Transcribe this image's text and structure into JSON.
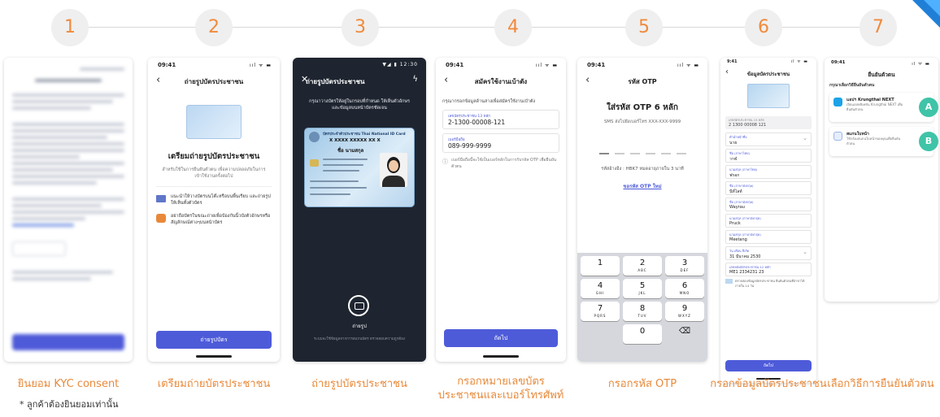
{
  "steps": [
    {
      "num": "1",
      "caption_lines": [
        "ยินยอม KYC consent"
      ]
    },
    {
      "num": "2",
      "caption_lines": [
        "เตรียมถ่ายบัตรประชาชน"
      ]
    },
    {
      "num": "3",
      "caption_lines": [
        "ถ่ายรูปบัตรประชาชน"
      ]
    },
    {
      "num": "4",
      "caption_lines": [
        "กรอกหมายเลขบัตร",
        "ประชาชนและเบอร์โทรศัพท์"
      ]
    },
    {
      "num": "5",
      "caption_lines": [
        "กรอกรหัส OTP"
      ]
    },
    {
      "num": "6",
      "caption_lines": [
        "กรอกข้อมูลบัตรประชาชน"
      ]
    },
    {
      "num": "7",
      "caption_lines": [
        "เลือกวิธีการยืนยันตัวตน"
      ]
    }
  ],
  "footnote": "* ลูกค้าต้องยินยอมเท่านั้น",
  "s2": {
    "time": "09:41",
    "title": "ถ่ายรูปบัตรประชาชน",
    "heading": "เตรียมถ่ายรูปบัตรประชาชน",
    "desc": "สำหรับใช้ในการยืนยันตัวตน เพื่อความปลอดภัยในการเข้าใช้งานครั้งต่อไป",
    "tip1": "แนะนำให้วางบัตรบนโต๊ะหรือบนพื้นเรียบ และถ่ายรูปให้เห็นทั้งตัวบัตร",
    "tip2": "อย่าถือบัตรในขณะถ่ายเพื่อป้องกันนิ้วบังตัวอักษรหรือสัญลักษณ์ต่างๆบนหน้าบัตร",
    "button": "ถ่ายรูปบัตร"
  },
  "s3": {
    "time": "12:30",
    "title": "ถ่ายรูปบัตรประชาชน",
    "hint": "กรุณาวางบัตรให้อยู่ในกรอบที่กำหนด ให้เห็นตัวอักษร และข้อมูลบนหน้าบัตรชัดเจน",
    "card_header": "บัตรประจำตัวประชาชน Thai National ID Card",
    "card_num": "X XXXX XXXXX XX X",
    "card_name": "ชื่อ นามสกุล",
    "shutter_label": "ถ่ายรูป",
    "footer": "ระบบจะใช้ข้อมูลจากการสแกนบัตร ตรวจสอบความถูกต้อง"
  },
  "s4": {
    "time": "09:41",
    "title": "สมัครใช้งานเบ้าตัง",
    "instruction": "กรุณากรอกข้อมูลด้านล่างเพื่อสมัครใช้งานเป๋าตัง",
    "id_label": "เลขบัตรประชาชน 13 หลัก",
    "id_value": "2-1300-00008-121",
    "phone_label": "เบอร์มือถือ",
    "phone_value": "089-999-9999",
    "note": "เบอร์มือถือนี้จะใช้เป็นเบอร์หลักในการรับรหัส OTP เพื่อยืนยันตัวตน",
    "button": "ถัดไป"
  },
  "s5": {
    "time": "09:41",
    "title": "รหัส OTP",
    "heading": "ใส่รหัส OTP 6 หลัก",
    "sent": "SMS ส่งไปยังเบอร์โทร XXX-XXX-9999",
    "ref": "รหัสอ้างอิง : HBK7 หมดอายุภายใน 3 นาที",
    "resend": "ขอรหัส OTP ใหม่",
    "keys": [
      {
        "n": "1",
        "l": ""
      },
      {
        "n": "2",
        "l": "ABC"
      },
      {
        "n": "3",
        "l": "DEF"
      },
      {
        "n": "4",
        "l": "GHI"
      },
      {
        "n": "5",
        "l": "JKL"
      },
      {
        "n": "6",
        "l": "MNO"
      },
      {
        "n": "7",
        "l": "PQRS"
      },
      {
        "n": "8",
        "l": "TUV"
      },
      {
        "n": "9",
        "l": "WXYZ"
      },
      {
        "n": "",
        "l": ""
      },
      {
        "n": "0",
        "l": ""
      },
      {
        "n": "⌫",
        "l": ""
      }
    ]
  },
  "s6": {
    "time": "9:41",
    "title": "ข้อมูลบัตรประชาชน",
    "id_label": "เลขบัตรประชาชน 13 หลัก",
    "id_value": "2 1300 00008 121",
    "fields": [
      {
        "label": "คำนำหน้าชื่อ",
        "value": "นาย"
      },
      {
        "label": "ชื่อ (ภาษาไทย)",
        "value": "วาฬ"
      },
      {
        "label": "นามสกุล (ภาษาไทย)",
        "value": "ฟรอก"
      },
      {
        "label": "ชื่อ (ภาษาอังกฤษ)",
        "value": "นีท์ไลท์"
      },
      {
        "label": "ชื่อ (ภาษาอังกฤษ)",
        "value": "Wayrau"
      },
      {
        "label": "นามสกุล (ภาษาอังกฤษ)",
        "value": "Pruck"
      },
      {
        "label": "นามสกุล (ภาษาอังกฤษ)",
        "value": "Meetang"
      },
      {
        "label": "วัน เดือน ปีเกิด",
        "value": "31 มีนาคม 2530"
      },
      {
        "label": "เลขหลังบัตรประชาชน 12 หลัก",
        "value": "ME1 2334231 23"
      }
    ],
    "footer_note": "ตรวจสอบข้อมูลบัตรประชาชน ยืนยันตัวตนที่สาขาได้ภายใน 14 วัน",
    "button": "ถัดไป"
  },
  "s7": {
    "time": "09:41",
    "title": "ยืนยันตัวตน",
    "subtitle": "กรุณาเลือกวิธียืนยันตัวตน",
    "opt1_title": "แอปฯ Krungthai NEXT",
    "opt1_desc": "เปิดแอปพลิเคชัน Krungthai NEXT เพื่อยืนยันตัวตน",
    "opt2_title": "สแกนใบหน้า",
    "opt2_desc": "ใช้กล้องสแกนใบหน้าของคุณเพื่อยืนยันตัวตน",
    "badge_a": "A",
    "badge_b": "B"
  },
  "colors": {
    "accent": "#4e5bd9",
    "orange": "#e8893a",
    "badge": "#3fc4a8"
  }
}
